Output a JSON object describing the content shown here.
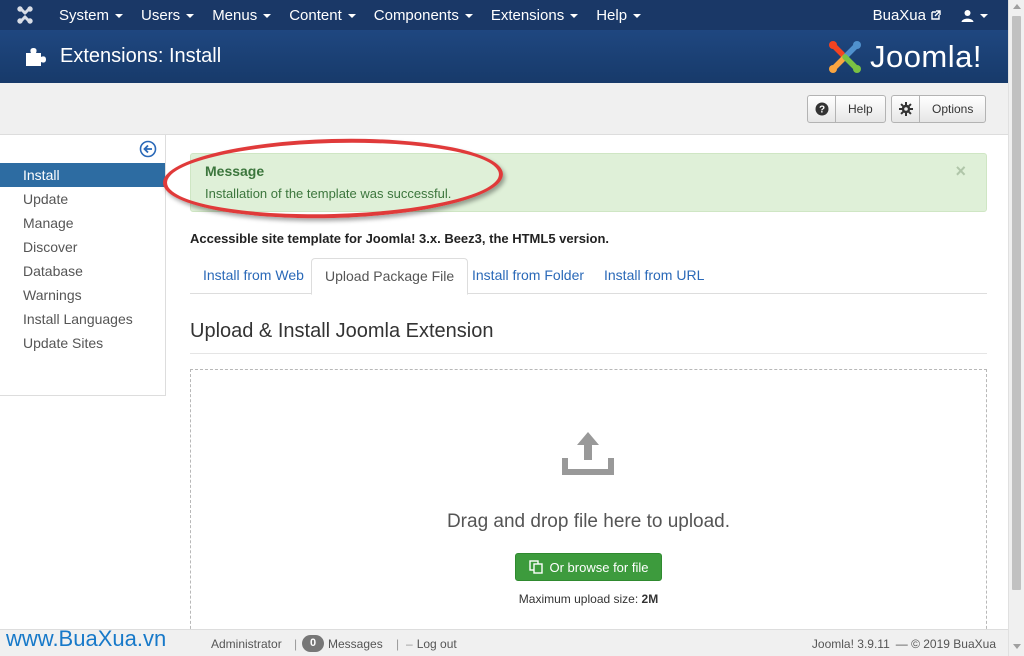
{
  "navbar": {
    "menu": [
      "System",
      "Users",
      "Menus",
      "Content",
      "Components",
      "Extensions",
      "Help"
    ],
    "user": "BuaXua"
  },
  "header": {
    "title": "Extensions: Install",
    "logo_text": "Joomla!"
  },
  "toolbar": {
    "help_label": "Help",
    "options_label": "Options"
  },
  "sidebar": {
    "items": [
      "Install",
      "Update",
      "Manage",
      "Discover",
      "Database",
      "Warnings",
      "Install Languages",
      "Update Sites"
    ],
    "active": "Install"
  },
  "alert": {
    "heading": "Message",
    "text": "Installation of the template was successful.",
    "close": "×"
  },
  "description": "Accessible site template for Joomla! 3.x. Beez3, the HTML5 version.",
  "tabs": [
    "Install from Web",
    "Upload Package File",
    "Install from Folder",
    "Install from URL"
  ],
  "active_tab": "Upload Package File",
  "section_title": "Upload & Install Joomla Extension",
  "dropzone": {
    "text": "Drag and drop file here to upload.",
    "browse_label": "Or browse for file",
    "max_size_label": "Maximum upload size:",
    "max_size_value": "2M"
  },
  "statusbar": {
    "admin_label": "Administrator",
    "messages_count": "0",
    "messages_label": "Messages",
    "logout_label": "Log out",
    "version": "Joomla! 3.9.11",
    "copyright": "— © 2019 BuaXua"
  },
  "watermark": "www.BuaXua.vn",
  "colors": {
    "navbar": "#1a3867",
    "header": "#1e4278",
    "sidebar_active": "#2d6ca2",
    "alert_bg": "#dff0d8",
    "alert_text": "#3c763d",
    "browse_button": "#3d9b3d",
    "annotation_ellipse": "#e03a3a"
  }
}
